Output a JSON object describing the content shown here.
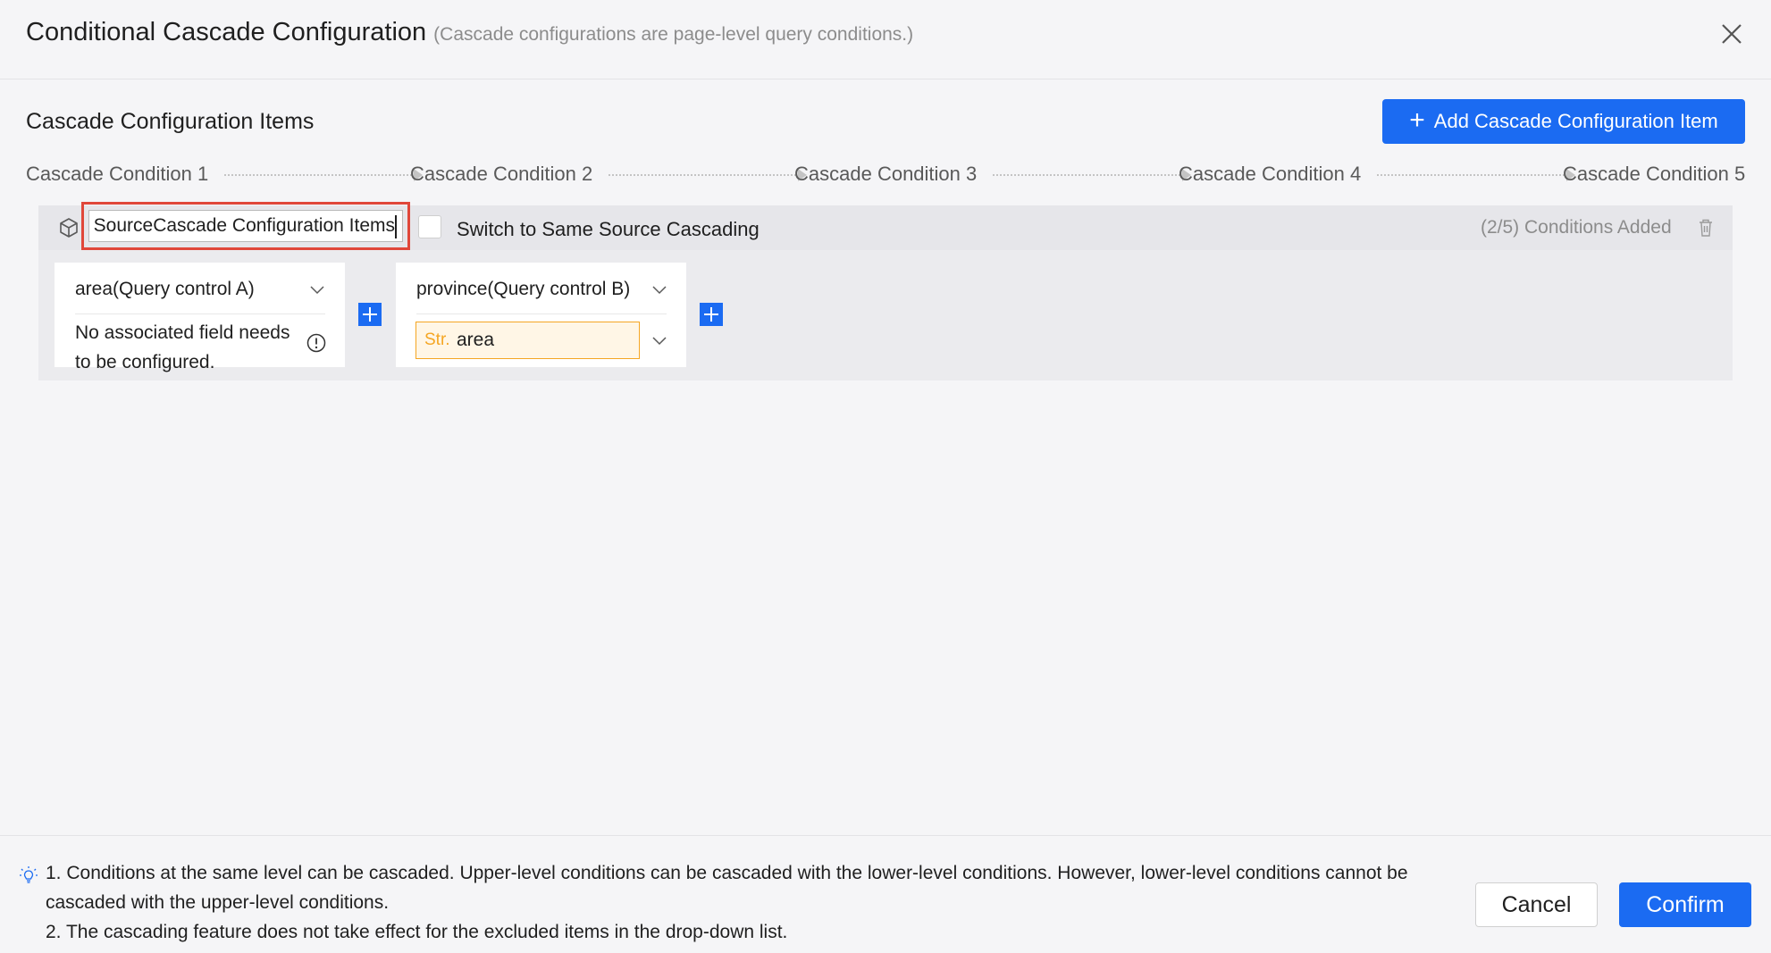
{
  "header": {
    "title": "Conditional Cascade Configuration",
    "subtitle": "(Cascade configurations are page-level query conditions.)"
  },
  "section": {
    "title": "Cascade Configuration Items",
    "add_button_label": "Add Cascade Configuration Item"
  },
  "steps": [
    "Cascade Condition 1",
    "Cascade Condition 2",
    "Cascade Condition 3",
    "Cascade Condition 4",
    "Cascade Condition 5"
  ],
  "item": {
    "name_value": "SourceCascade Configuration Items",
    "same_source_label": "Switch to Same Source Cascading",
    "same_source_checked": false,
    "count_label": "(2/5) Conditions Added",
    "conditions": [
      {
        "control_label": "area(Query control A)",
        "note": "No associated field needs to be configured."
      },
      {
        "control_label": "province(Query control B)",
        "field_type": "Str.",
        "field_name": "area"
      }
    ]
  },
  "footer": {
    "tips": [
      "1. Conditions at the same level can be cascaded. Upper-level conditions can be cascaded with the lower-level conditions. However, lower-level conditions cannot be",
      "cascaded with the upper-level conditions.",
      "2. The cascading feature does not take effect for the excluded items in the drop-down list."
    ],
    "cancel_label": "Cancel",
    "confirm_label": "Confirm"
  },
  "colors": {
    "primary": "#1b6bf2",
    "highlight_border": "#e0473a",
    "field_type": "#f5a623"
  }
}
